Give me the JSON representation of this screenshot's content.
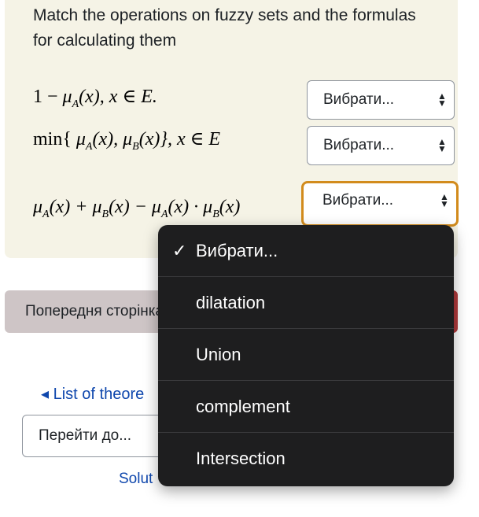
{
  "question": {
    "text": "Match the operations on fuzzy sets and the formulas for calculating them",
    "formulas": [
      {
        "prefix": "1 − ",
        "mu": "μ",
        "sub_a": "A",
        "arg": "(x), x ∈ E."
      },
      {
        "prefix": "min{ ",
        "mu": "μ",
        "sub_a": "A",
        "arg_a": "(x), ",
        "mu_b": "μ",
        "sub_b": "B",
        "arg_b": "(x)},   x ∈ E"
      },
      {
        "mu": "μ",
        "sub_a": "A",
        "t1": "(x) + ",
        "sub_b": "B",
        "t2": "(x) − ",
        "t3": "(x) · ",
        "t4": "(x)"
      }
    ],
    "selects": [
      {
        "value": "Вибрати..."
      },
      {
        "value": "Вибрати..."
      },
      {
        "value": "Вибрати..."
      }
    ]
  },
  "dropdown": {
    "options": [
      "Вибрати...",
      "dilatation",
      "Union",
      "complement",
      "Intersection"
    ],
    "selected_index": 0
  },
  "navigation": {
    "prev_label": "Попередня сторінка",
    "theory_link": "◂ List of theore",
    "goto_label": "Перейти до...",
    "solution_link": "Solut"
  },
  "colors": {
    "card_bg": "#f5f3e6",
    "focus_ring": "#d28b1c",
    "menu_bg": "#1e1e1f",
    "link": "#0f47ad",
    "prev_button": "#cec5c6",
    "next_button": "#b03a3c"
  },
  "icons": {
    "select_arrows": "updown-chevron-icon",
    "check": "checkmark-icon"
  }
}
